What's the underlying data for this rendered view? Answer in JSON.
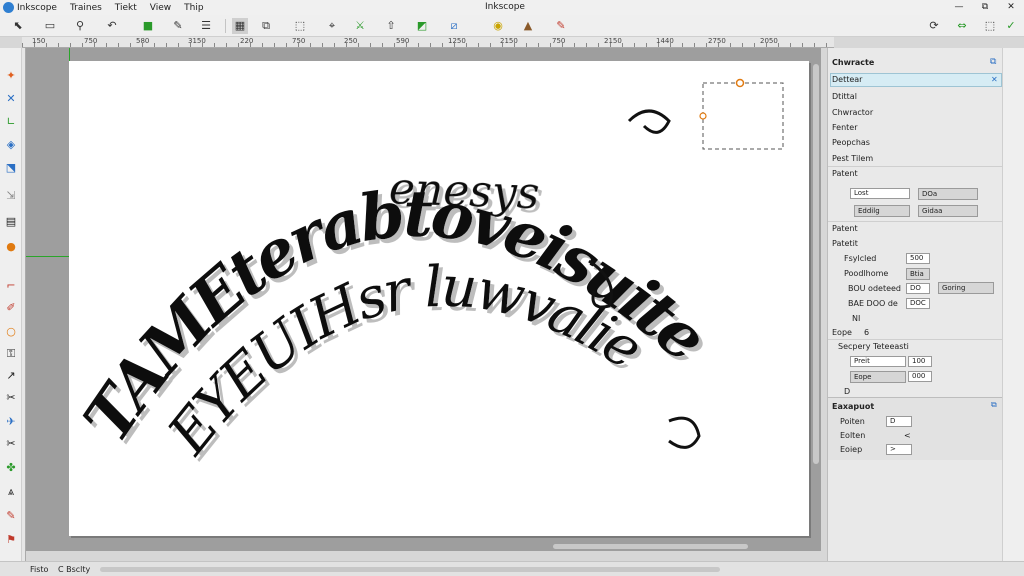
{
  "window": {
    "app_name": "Inkscope",
    "title": "Inkscope",
    "menus": [
      "Traines",
      "Tiekt",
      "View",
      "Thip"
    ],
    "controls": [
      "—",
      "⧉",
      "✕"
    ]
  },
  "toolbar": {
    "icons": [
      "select-tool-icon",
      "rect-tool-icon",
      "zoom-tool-icon",
      "undo-icon",
      "node-tool-icon",
      "bezier-tool-icon",
      "align-icon",
      "group-icon",
      "layers-icon",
      "transform-icon",
      "snap-icon",
      "pen-tool-icon",
      "calligraphy-icon",
      "text-tool-icon",
      "spray-icon",
      "fill-icon",
      "gradient-icon",
      "dropper-icon",
      "spiral-icon",
      "export-icon",
      "import-icon",
      "check-icon"
    ]
  },
  "ruler": {
    "labels": [
      "150",
      "750",
      "580",
      "3150",
      "220",
      "750",
      "250",
      "590",
      "1250",
      "2150",
      "750",
      "2150",
      "1440",
      "2750",
      "2050"
    ]
  },
  "artwork": {
    "outer_words": [
      {
        "text": "enesys",
        "rotate": 2,
        "size": 44
      },
      {
        "text": "E",
        "rotate": -20,
        "size": 60
      }
    ],
    "arc_text": "TAMEterabtoveisuite",
    "inner_text": "EYEUIHsr luwvalie",
    "ink_color": "#111111",
    "shadow_color": "#bdbdbd"
  },
  "panel": {
    "header": "Chwracte",
    "selected_item": "Dettear",
    "rows": {
      "title2": "Dtittal",
      "char": "Chwractor",
      "font_label": "Fenter",
      "dropshadow": "Peopchas",
      "font_line": "Pest Tilem",
      "paragraph": "Patent",
      "font_size_label": "Lost",
      "font_size_val": "DOa",
      "style_dd": "Eddilg",
      "unit_dd": "Gidaa",
      "font_section": "Patent",
      "font_val_label": "Patetit",
      "kerning_label": "Fsylcled",
      "kerning_val": "500",
      "spacing_label": "Poodlhome",
      "spacing_val": "Btia",
      "letter_label": "BOU odeteed",
      "letter_val": "DO",
      "letter_dd": "Goring",
      "word_label": "BAE DOO de",
      "word_val": "DOC",
      "misc1": "NI",
      "edge_label": "Eope",
      "edge_val": "6",
      "section2": "Secpery Teteeasti",
      "paint_label": "Preit",
      "paint_val": "100",
      "color_dd": "Eope",
      "color_val": "000",
      "d_label": "D"
    },
    "bottom": {
      "header": "Eaxapuot",
      "items": [
        {
          "label": "Poiten",
          "value": "D"
        },
        {
          "label": "Eolten",
          "value": "<"
        },
        {
          "label": "Eoiep",
          "value": ">"
        }
      ]
    }
  },
  "status": {
    "left": "Fisto",
    "mid": "C Bsclty"
  }
}
